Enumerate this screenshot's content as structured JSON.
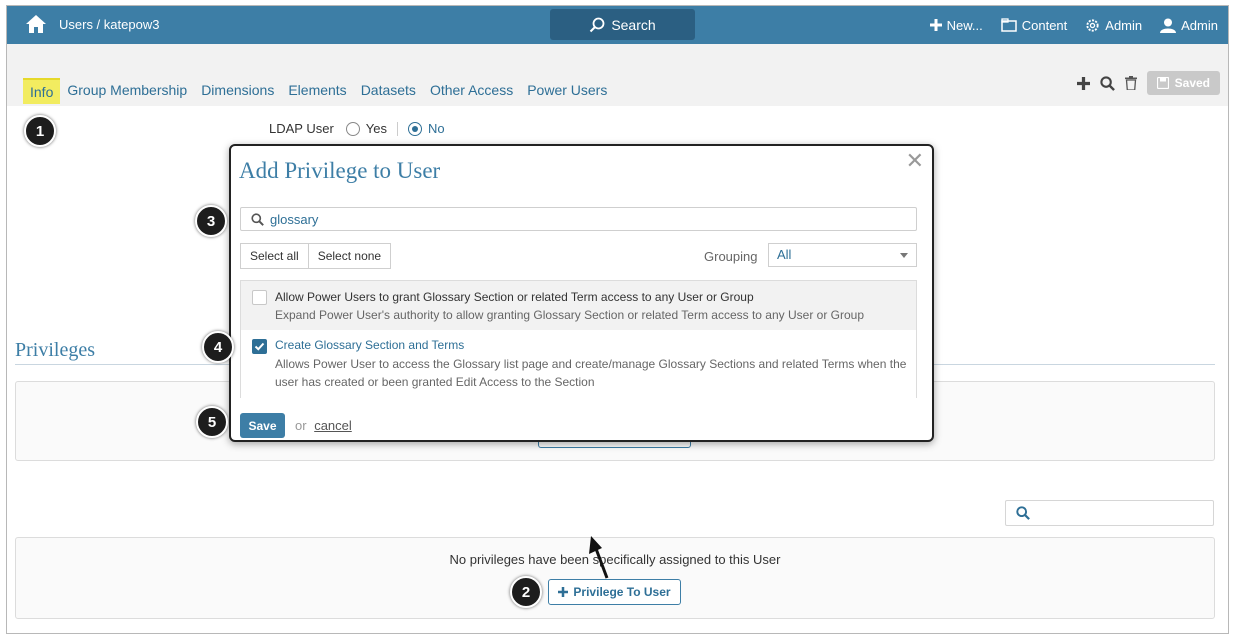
{
  "topbar": {
    "breadcrumb": "Users / katepow3",
    "search_label": "Search",
    "nav": [
      {
        "label": "New...",
        "icon": "plus-icon"
      },
      {
        "label": "Content",
        "icon": "content-icon"
      },
      {
        "label": "Admin",
        "icon": "gear-icon"
      },
      {
        "label": "Admin",
        "icon": "user-icon"
      }
    ]
  },
  "tabs": [
    {
      "label": "Info",
      "active": true
    },
    {
      "label": "Group Membership"
    },
    {
      "label": "Dimensions"
    },
    {
      "label": "Elements"
    },
    {
      "label": "Datasets"
    },
    {
      "label": "Other Access"
    },
    {
      "label": "Power Users"
    }
  ],
  "tab_tools": {
    "saved_label": "Saved"
  },
  "ldap": {
    "label": "LDAP User",
    "yes": "Yes",
    "no": "No",
    "selected": "No"
  },
  "privileges": {
    "title": "Privileges",
    "empty_text": "No privileges have been specifically assigned to this User",
    "add_label": "Privilege To User"
  },
  "modal": {
    "title": "Add Privilege to User",
    "search_value": "glossary",
    "select_all": "Select all",
    "select_none": "Select none",
    "grouping_label": "Grouping",
    "grouping_value": "All",
    "items": [
      {
        "title": "Allow Power Users to grant Glossary Section or related Term access to any User or Group",
        "description": "Expand Power User's authority to allow granting Glossary Section or related Term access to any User or Group",
        "checked": false
      },
      {
        "title": "Create Glossary Section and Terms",
        "description": "Allows Power User to access the Glossary list page and create/manage Glossary Sections and related Terms when the user has created or been granted Edit Access to the Section",
        "checked": true
      }
    ],
    "save_label": "Save",
    "or_text": "or",
    "cancel_label": "cancel"
  },
  "callouts": [
    "1",
    "2",
    "3",
    "4",
    "5"
  ],
  "colors": {
    "primary": "#3d7ea6",
    "topbar": "#3d7ea6",
    "highlight": "#f2ec60"
  }
}
